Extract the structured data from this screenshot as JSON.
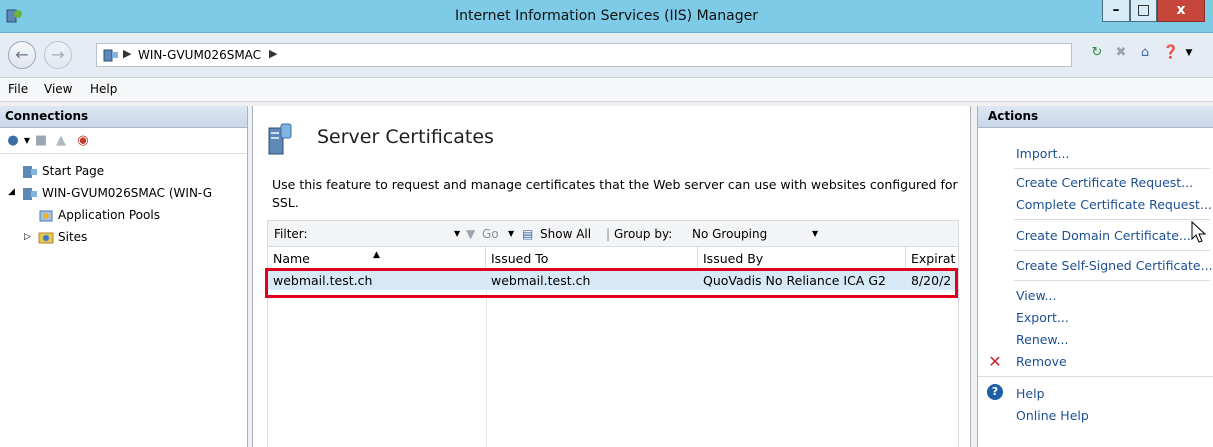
{
  "window": {
    "title": "Internet Information Services (IIS) Manager",
    "min_glyph": "–",
    "max_glyph": "□",
    "close_glyph": "x"
  },
  "address": {
    "server": "WIN-GVUM026SMAC"
  },
  "menu": {
    "file": "File",
    "view": "View",
    "help": "Help"
  },
  "connections": {
    "title": "Connections",
    "tree": {
      "start_page": "Start Page",
      "server": "WIN-GVUM026SMAC (WIN-G",
      "app_pools": "Application Pools",
      "sites": "Sites"
    }
  },
  "feature": {
    "title": "Server Certificates",
    "description": "Use this feature to request and manage certificates that the Web server can use with websites configured for SSL.",
    "filter_label": "Filter:",
    "go_label": "Go",
    "show_all_label": "Show All",
    "group_by_label": "Group by:",
    "group_by_value": "No Grouping",
    "columns": [
      "Name",
      "Issued To",
      "Issued By",
      "Expirat"
    ],
    "rows": [
      {
        "name": "webmail.test.ch",
        "issued_to": "webmail.test.ch",
        "issued_by": "QuoVadis No Reliance ICA G2",
        "expiration": "8/20/2"
      }
    ]
  },
  "actions": {
    "title": "Actions",
    "import": "Import...",
    "create_request": "Create Certificate Request...",
    "complete_request": "Complete Certificate Request...",
    "create_domain": "Create Domain Certificate...",
    "create_self_signed": "Create Self-Signed Certificate...",
    "view": "View...",
    "export": "Export...",
    "renew": "Renew...",
    "remove": "Remove",
    "help": "Help",
    "online_help": "Online Help"
  },
  "colors": {
    "titlebar": "#7ecbe8",
    "link": "#1d4f91",
    "selection": "#d7e9f7",
    "highlight_border": "#e0001b",
    "remove_icon": "#d2262a"
  }
}
